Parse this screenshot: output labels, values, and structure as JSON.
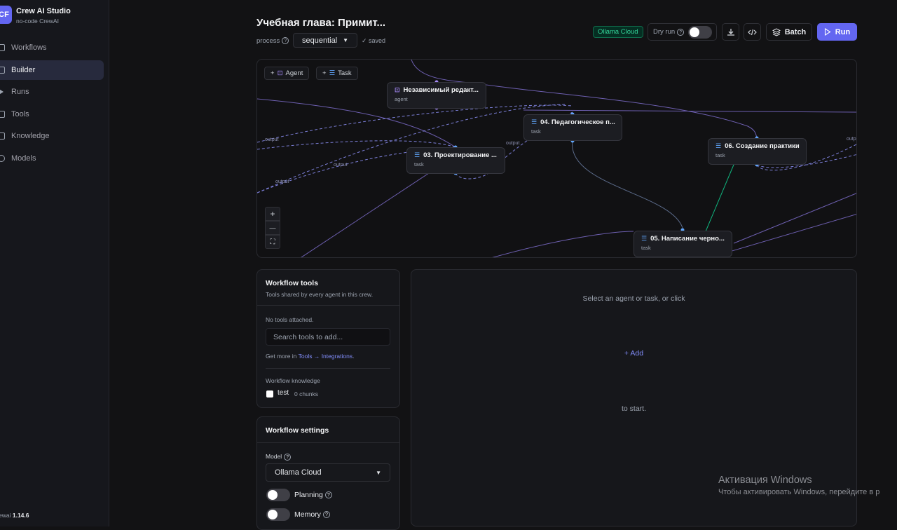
{
  "app": {
    "logo": "CF",
    "name": "Crew AI Studio",
    "subtitle": "no-code CrewAI"
  },
  "sidebar": {
    "items": [
      {
        "label": "Workflows",
        "icon": "workflow-icon"
      },
      {
        "label": "Builder",
        "icon": "builder-icon",
        "active": true
      },
      {
        "label": "Runs",
        "icon": "play-icon"
      },
      {
        "label": "Tools",
        "icon": "wrench-icon"
      },
      {
        "label": "Knowledge",
        "icon": "book-icon"
      },
      {
        "label": "Models",
        "icon": "model-icon"
      }
    ],
    "version_prefix": "ewai",
    "version": "1.14.6"
  },
  "header": {
    "title": "Учебная глава: Примит...",
    "process_label": "process",
    "process_value": "sequential",
    "saved": "✓ saved",
    "model_badge": "Ollama Cloud",
    "dry_run_label": "Dry run",
    "batch_label": "Batch",
    "run_label": "Run"
  },
  "canvas": {
    "add_agent": "Agent",
    "add_task": "Task",
    "nodes": [
      {
        "title": "Независимый редакт...",
        "type": "agent"
      },
      {
        "title": "04. Педагогическое п...",
        "type": "task"
      },
      {
        "title": "03. Проектирование ...",
        "type": "task"
      },
      {
        "title": "06. Создание практики",
        "type": "task"
      },
      {
        "title": "05. Написание черно...",
        "type": "task"
      }
    ],
    "edge_label": "output",
    "edge_label_short": "outp",
    "zoom_in": "+",
    "zoom_out": "—",
    "fit": "⛶"
  },
  "tools_panel": {
    "title": "Workflow tools",
    "subtitle": "Tools shared by every agent in this crew.",
    "empty": "No tools attached.",
    "search_placeholder": "Search tools to add...",
    "get_more_prefix": "Get more in",
    "get_more_link": "Tools → Integrations",
    "get_more_suffix": ".",
    "knowledge_title": "Workflow knowledge",
    "knowledge_item": "test",
    "knowledge_chunks": "0 chunks"
  },
  "settings_panel": {
    "title": "Workflow settings",
    "model_label": "Model",
    "model_value": "Ollama Cloud",
    "planning_label": "Planning",
    "memory_label": "Memory"
  },
  "detail": {
    "line1": "Select an agent or task, or click",
    "add": "+ Add",
    "line2": "to start."
  },
  "watermark": {
    "title": "Активация Windows",
    "text": "Чтобы активировать Windows, перейдите в р"
  }
}
